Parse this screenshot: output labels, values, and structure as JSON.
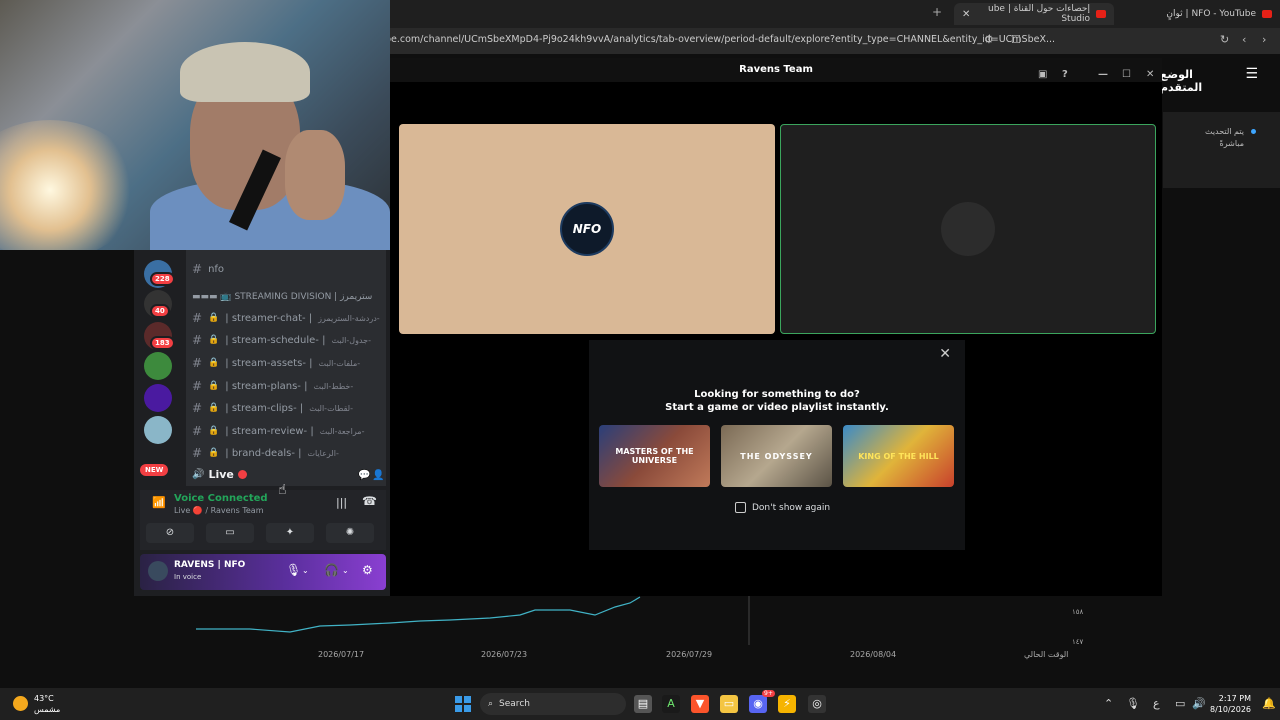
{
  "browser": {
    "tab_active_title": "إحصاءات حول القناة | ube Studio",
    "tab_2_title": "NFO - YouTube | ثوانٍ",
    "url": "be.com/channel/UCmSbeXMpD4-Pj9o24kh9vvA/analytics/tab-overview/period-default/explore?entity_type=CHANNEL&entity_id=UCmSbeX..."
  },
  "studio": {
    "header_title": "الوضع المتقدم",
    "live_update_line1": "يتم التحديث",
    "live_update_line2": "مباشرةً",
    "chart_x_labels": [
      "2026/07/17",
      "2026/07/23",
      "2026/07/29",
      "2026/08/04",
      "الوقت الحالي"
    ],
    "chart_y_labels": [
      "١٥٨",
      "١٤٧"
    ]
  },
  "discord": {
    "window_title": "Ravens Team",
    "server_badges": [
      "228",
      "40",
      "183"
    ],
    "new_label": "NEW",
    "top_channel": "nfo",
    "category": "▬▬▬ 📺 STREAMING DIVISION | ستريمرز",
    "channels": [
      {
        "name": "| streamer-chat- |",
        "arabic": "دردشة-الستريمرز-"
      },
      {
        "name": "| stream-schedule- |",
        "arabic": "جدول-البث-"
      },
      {
        "name": "| stream-assets- |",
        "arabic": "ملفات-البث-"
      },
      {
        "name": "| stream-plans- |",
        "arabic": "خطط-البث-"
      },
      {
        "name": "| stream-clips- |",
        "arabic": "لقطات-البث-"
      },
      {
        "name": "| stream-review- |",
        "arabic": "مراجعة-البث-"
      },
      {
        "name": "| brand-deals- |",
        "arabic": "الرعايات-"
      }
    ],
    "voice_channel": "Live",
    "voice_connected": "Voice Connected",
    "voice_location": "Live 🔴 / Ravens Team",
    "username": "RAVENS | NFO",
    "user_status": "In voice",
    "tile_a_label": "NFO",
    "activity_title_line1": "Looking for something to do?",
    "activity_title_line2": "Start a game or video playlist instantly.",
    "activity_cards": [
      "MASTERS OF THE UNIVERSE",
      "THE ODYSSEY",
      "KING OF THE HILL"
    ],
    "dont_show_again": "Don't show again"
  },
  "taskbar": {
    "temperature": "43°C",
    "weather_desc": "مشمس",
    "search_placeholder": "Search",
    "time": "2:17 PM",
    "date": "8/10/2026",
    "lang": "ع",
    "discord_badge": "9+"
  },
  "colors": {
    "discord_green": "#23a55a",
    "discord_red": "#f23f43",
    "lock_yellow": "#d9a43a",
    "boost_purple": "#8a3fd1"
  }
}
